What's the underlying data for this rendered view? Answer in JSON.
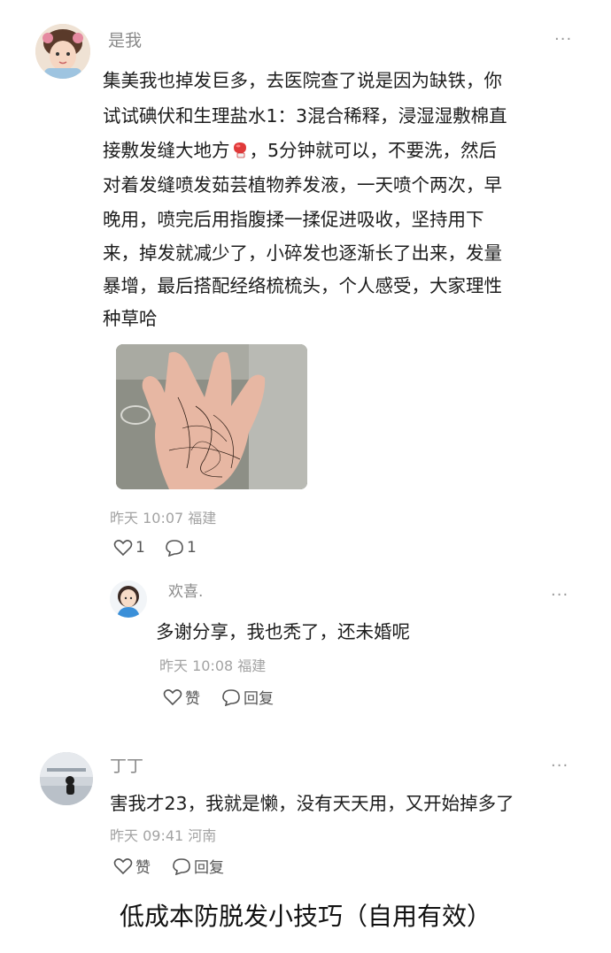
{
  "comments": [
    {
      "username": "是我",
      "text_lines": [
        "集美我也掉发巨多，去医院查了说是因为缺铁，你",
        "试试碘伏和生理盐水1：3混合稀释，浸湿湿敷棉直",
        "接敷发缝大地方",
        "，5分钟就可以，不要洗，然后",
        "对着发缝喷发茹芸植物养发液，一天喷个两次，早",
        "晚用，喷完后用指腹揉一揉促进吸收，坚持用下",
        "来，掉发就减少了，小碎发也逐渐长了出来，发量",
        "暴增，最后搭配经络梳梳头，个人感受，大家理性",
        "种草哈"
      ],
      "inline_emoji": "boxing-glove-icon",
      "has_photo": true,
      "time": "昨天 10:07",
      "location": "福建",
      "likes": "1",
      "replies": "1",
      "more": "···"
    },
    {
      "username": "欢喜.",
      "text": "多谢分享，我也秃了，还未婚呢",
      "time": "昨天 10:08",
      "location": "福建",
      "like_label": "赞",
      "reply_label": "回复",
      "more": "···"
    },
    {
      "username": "丁丁",
      "text": "害我才23，我就是懒，没有天天用，又开始掉多了",
      "time": "昨天 09:41",
      "location": "河南",
      "like_label": "赞",
      "reply_label": "回复",
      "more": "···"
    }
  ],
  "caption": "低成本防脱发小技巧（自用有效）",
  "colors": {
    "username": "#8a8a8a",
    "meta": "#a3a3a3",
    "text": "#1d1d1d",
    "icon": "#555555"
  }
}
